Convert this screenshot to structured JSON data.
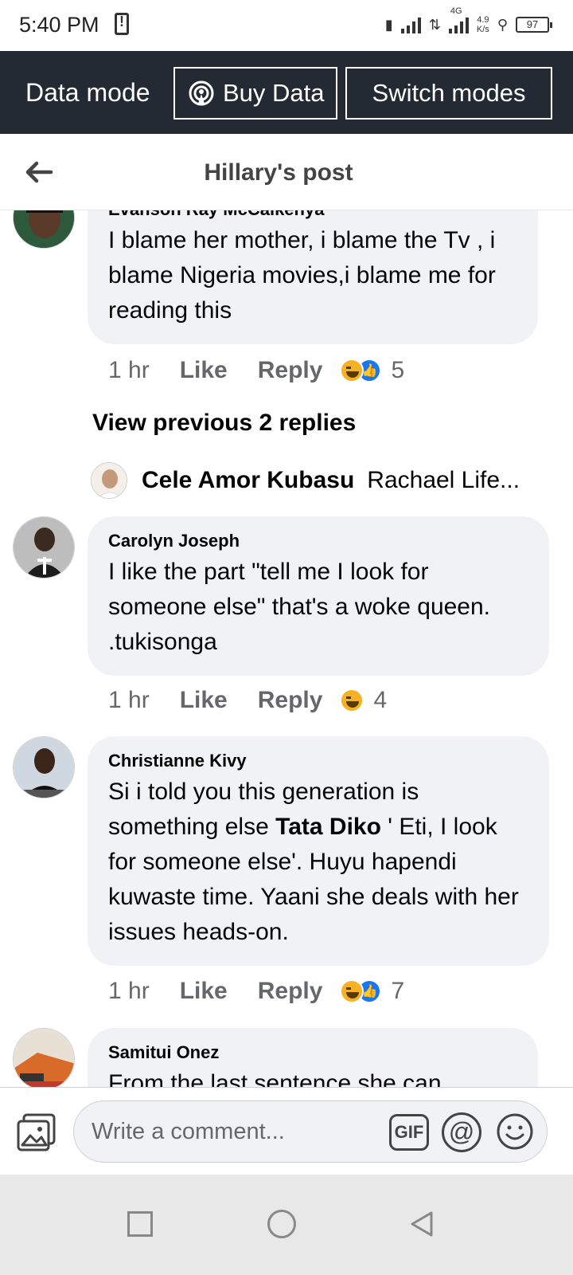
{
  "status_bar": {
    "time": "5:40 PM",
    "network_type": "4G",
    "net_speed_value": "4.9",
    "net_speed_unit": "K/s",
    "battery": "97"
  },
  "data_bar": {
    "mode_label": "Data mode",
    "buy_data_label": "Buy Data",
    "switch_modes_label": "Switch modes"
  },
  "header": {
    "title": "Hillary's post"
  },
  "comments": [
    {
      "author": "Evanson Ray McCalkenya",
      "text": "I blame her mother, i blame the Tv , i blame Nigeria movies,i blame me for reading this",
      "time": "1 hr",
      "like_label": "Like",
      "reply_label": "Reply",
      "reaction_count": "5"
    },
    {
      "author": "Carolyn Joseph",
      "text": "I like the part \"tell me I look for someone else\" that's a woke queen. .tukisonga",
      "time": "1 hr",
      "like_label": "Like",
      "reply_label": "Reply",
      "reaction_count": "4"
    },
    {
      "author": "Christianne Kivy",
      "text_before": "Si i told you this generation is something else ",
      "mention": "Tata Diko",
      "text_after": " ' Eti, I look for someone else'. Huyu hapendi kuwaste time. Yaani she deals with her issues heads-on.",
      "time": "1 hr",
      "like_label": "Like",
      "reply_label": "Reply",
      "reaction_count": "7"
    },
    {
      "author": "Samitui Onez",
      "text": "From the last sentence she can"
    }
  ],
  "replies": {
    "view_previous": "View previous 2 replies",
    "latest_author": "Cele Amor Kubasu",
    "latest_preview": "Rachael Life..."
  },
  "composer": {
    "placeholder": "Write a comment...",
    "gif_label": "GIF"
  },
  "colors": {
    "data_bar_bg": "#242a33",
    "bubble_bg": "#f0f2f5",
    "like_blue": "#1877f2",
    "haha_yellow": "#f7b125"
  }
}
